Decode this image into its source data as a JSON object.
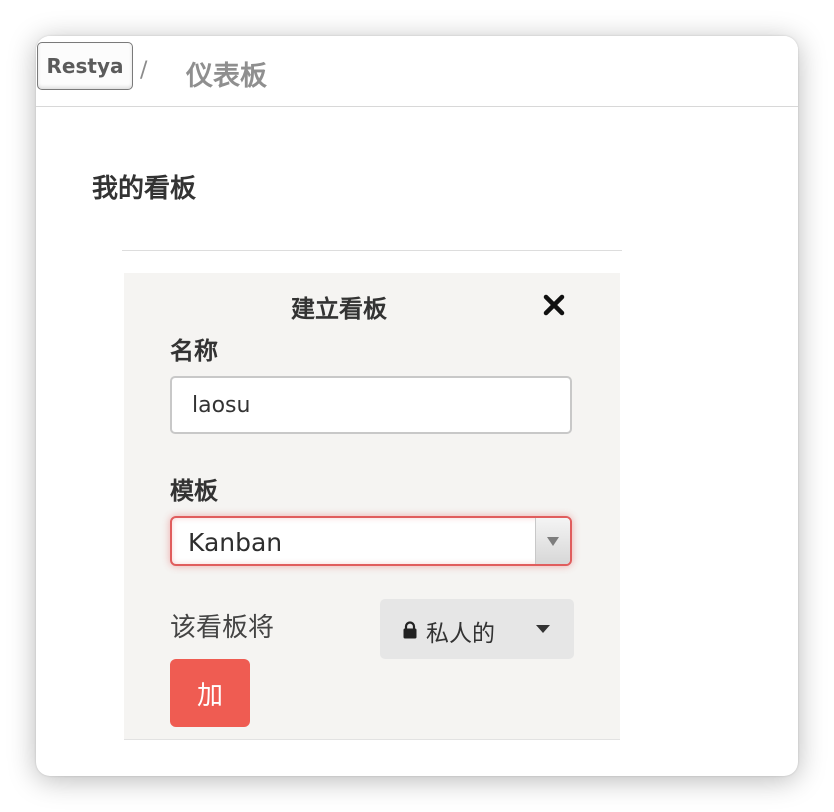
{
  "header": {
    "logo_text": "Restya",
    "separator": "/",
    "title": "仪表板"
  },
  "main": {
    "section_title": "我的看板"
  },
  "create_board": {
    "title": "建立看板",
    "close_icon": "close-icon",
    "name_label": "名称",
    "name_value": "laosu",
    "template_label": "模板",
    "template_value": "Kanban",
    "visibility_prefix": "该看板将",
    "visibility_icon": "lock-icon",
    "visibility_value": "私人的",
    "submit_label": "加"
  },
  "colors": {
    "accent": "#ef5c52",
    "select_border": "#e05d5d",
    "panel_bg": "#f5f4f2",
    "header_text": "#8f8f8f"
  }
}
